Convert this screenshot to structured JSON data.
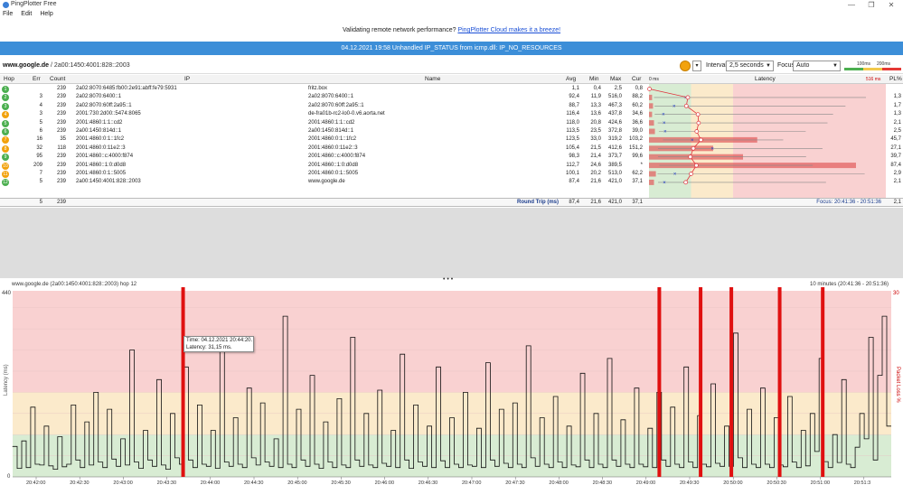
{
  "window": {
    "title": "PingPlotter Free",
    "minimize": "—",
    "maximize": "❐",
    "close": "✕"
  },
  "menu": [
    "File",
    "Edit",
    "Help"
  ],
  "promo": {
    "text": "Validating remote network performance?",
    "link": "PingPlotter Cloud makes it a breeze!"
  },
  "error": "04.12.2021 19:58 Unhandled IP_STATUS from icmp.dll: IP_NO_RESOURCES",
  "target": {
    "host": "www.google.de",
    "ip": "/ 2a00:1450:4001:828::2003"
  },
  "controls": {
    "interval_label": "Interval",
    "interval_value": "2,5 seconds",
    "focus_label": "Focus",
    "focus_value": "Auto"
  },
  "scale": {
    "t1": "100ms",
    "t2": "200ms"
  },
  "columns": {
    "hop": "Hop",
    "err": "Err",
    "count": "Count",
    "ip": "IP",
    "name": "Name",
    "avg": "Avg",
    "min": "Min",
    "max": "Max",
    "cur": "Cur",
    "lat0": "0 ms",
    "latency": "Latency",
    "latmax": "516 ms",
    "pl": "PL%"
  },
  "hops": [
    {
      "hop": "1",
      "err": "",
      "count": "239",
      "ip": "2a02:8070:6485:fb00:2e91:abff:fe79:5931",
      "name": "fritz.box",
      "avg": "1,1",
      "min": "0,4",
      "max": "2,5",
      "cur": "0,8",
      "pl": "",
      "color": "#4caf50",
      "avgv": 1.1,
      "minv": 0.4,
      "maxv": 2.5
    },
    {
      "hop": "2",
      "err": "3",
      "count": "239",
      "ip": "2a02:8070:6400::1",
      "name": "2a02:8070:6400::1",
      "avg": "92,4",
      "min": "11,9",
      "max": "516,0",
      "cur": "88,2",
      "pl": "1,3",
      "color": "#4caf50",
      "avgv": 92.4,
      "minv": 11.9,
      "maxv": 516
    },
    {
      "hop": "3",
      "err": "4",
      "count": "239",
      "ip": "2a02:8070:60ff:2a95::1",
      "name": "2a02:8070:60ff:2a95::1",
      "avg": "88,7",
      "min": "13,3",
      "max": "467,3",
      "cur": "60,2",
      "pl": "1,7",
      "color": "#4caf50",
      "avgv": 88.7,
      "minv": 13.3,
      "maxv": 467.3
    },
    {
      "hop": "4",
      "err": "3",
      "count": "239",
      "ip": "2001:730:2d00::5474:8065",
      "name": "de-fra01b-rc2-lo0-0.v6.aorta.net",
      "avg": "116,4",
      "min": "13,6",
      "max": "437,8",
      "cur": "34,6",
      "pl": "1,3",
      "color": "#f2a20d",
      "avgv": 116.4,
      "minv": 13.6,
      "maxv": 437.8
    },
    {
      "hop": "5",
      "err": "5",
      "count": "239",
      "ip": "2001:4860:1:1::cd2",
      "name": "2001:4860:1:1::cd2",
      "avg": "118,0",
      "min": "20,8",
      "max": "424,6",
      "cur": "36,6",
      "pl": "2,1",
      "color": "#4caf50",
      "avgv": 118,
      "minv": 20.8,
      "maxv": 424.6
    },
    {
      "hop": "6",
      "err": "6",
      "count": "239",
      "ip": "2a00:1450:814d::1",
      "name": "2a00:1450:814d::1",
      "avg": "113,5",
      "min": "23,5",
      "max": "372,8",
      "cur": "39,0",
      "pl": "2,5",
      "color": "#4caf50",
      "avgv": 113.5,
      "minv": 23.5,
      "maxv": 372.8
    },
    {
      "hop": "7",
      "err": "16",
      "count": "35",
      "ip": "2001:4860:0:1::1fc2",
      "name": "2001:4860:0:1::1fc2",
      "avg": "123,5",
      "min": "33,0",
      "max": "319,2",
      "cur": "103,2",
      "pl": "45,7",
      "color": "#f2a20d",
      "avgv": 123.5,
      "minv": 33,
      "maxv": 319.2
    },
    {
      "hop": "8",
      "err": "32",
      "count": "118",
      "ip": "2001:4860:0:11e2::3",
      "name": "2001:4860:0:11e2::3",
      "avg": "105,4",
      "min": "21,5",
      "max": "412,6",
      "cur": "151,2",
      "pl": "27,1",
      "color": "#f2a20d",
      "avgv": 105.4,
      "minv": 21.5,
      "maxv": 412.6
    },
    {
      "hop": "9",
      "err": "95",
      "count": "239",
      "ip": "2001:4860::c:4000:f874",
      "name": "2001:4860::c:4000:f874",
      "avg": "98,3",
      "min": "21,4",
      "max": "373,7",
      "cur": "99,6",
      "pl": "39,7",
      "color": "#4caf50",
      "avgv": 98.3,
      "minv": 21.4,
      "maxv": 373.7
    },
    {
      "hop": "10",
      "err": "209",
      "count": "239",
      "ip": "2001:4860::1:0:d0d8",
      "name": "2001:4860::1:0:d0d8",
      "avg": "112,7",
      "min": "24,6",
      "max": "389,5",
      "cur": "*",
      "pl": "87,4",
      "color": "#f2a20d",
      "avgv": 112.7,
      "minv": 24.6,
      "maxv": 389.5
    },
    {
      "hop": "11",
      "err": "7",
      "count": "239",
      "ip": "2001:4860:0:1::5005",
      "name": "2001:4860:0:1::5005",
      "avg": "100,1",
      "min": "20,2",
      "max": "513,0",
      "cur": "62,2",
      "pl": "2,9",
      "color": "#f2a20d",
      "avgv": 100.1,
      "minv": 20.2,
      "maxv": 513
    },
    {
      "hop": "12",
      "err": "5",
      "count": "239",
      "ip": "2a00:1450:4001:828::2003",
      "name": "www.google.de",
      "avg": "87,4",
      "min": "21,6",
      "max": "421,0",
      "cur": "37,1",
      "pl": "2,1",
      "color": "#4caf50",
      "avgv": 87.4,
      "minv": 21.6,
      "maxv": 421
    }
  ],
  "summary": {
    "err": "5",
    "count": "239",
    "label": "Round Trip (ms)",
    "avg": "87,4",
    "min": "21,6",
    "max": "421,0",
    "cur": "37,1",
    "focus": "Focus: 20:41:36 - 20:51:36",
    "pl": "2,1"
  },
  "graph": {
    "title": "www.google.de (2a00:1450:4001:828::2003) hop 12",
    "range": "10 minutes (20:41:36 - 20:51:36)",
    "ylabel": "Latency (ms)",
    "yright": "Packet Loss %",
    "ymax": "440",
    "ymin": "0",
    "pmax": "30",
    "xticks": [
      "20:42:00",
      "20:42:30",
      "20:43:00",
      "20:43:30",
      "20:44:00",
      "20:44:30",
      "20:45:00",
      "20:45:30",
      "20:46:00",
      "20:46:30",
      "20:47:00",
      "20:47:30",
      "20:48:00",
      "20:48:30",
      "20:49:00",
      "20:49:30",
      "20:50:00",
      "20:50:30",
      "20:51:00",
      "20:51:3"
    ],
    "tooltip": {
      "line1": "Time: 04.12.2021 20:44:20.",
      "line2": "Latency: 31,15 ms."
    }
  },
  "chart_data": {
    "type": "line",
    "ylabel": "Latency (ms)",
    "ylim": [
      0,
      440
    ],
    "bands": [
      {
        "from": 0,
        "to": 100,
        "color": "#d8ecd3"
      },
      {
        "from": 100,
        "to": 200,
        "color": "#fbeacb"
      },
      {
        "from": 200,
        "to": 440,
        "color": "#f9d1d1"
      }
    ],
    "loss_x": [
      0.194,
      0.736,
      0.783,
      0.818,
      0.873,
      0.922
    ],
    "values": [
      72,
      20,
      85,
      22,
      165,
      30,
      28,
      120,
      26,
      18,
      95,
      24,
      30,
      170,
      40,
      22,
      130,
      28,
      200,
      35,
      22,
      160,
      42,
      25,
      90,
      28,
      300,
      35,
      20,
      110,
      40,
      25,
      230,
      28,
      18,
      150,
      45,
      30,
      260,
      40,
      22,
      170,
      30,
      25,
      110,
      20,
      320,
      35,
      25,
      140,
      30,
      22,
      210,
      45,
      28,
      175,
      35,
      25,
      90,
      22,
      380,
      30,
      22,
      160,
      40,
      25,
      240,
      30,
      20,
      130,
      35,
      22,
      185,
      28,
      22,
      330,
      40,
      25,
      150,
      28,
      22,
      205,
      32,
      25,
      110,
      22,
      290,
      40,
      20,
      170,
      35,
      25,
      120,
      22,
      260,
      38,
      22,
      140,
      30,
      22,
      200,
      28,
      25,
      115,
      22,
      270,
      40,
      25,
      160,
      32,
      22,
      175,
      30,
      22,
      310,
      45,
      25,
      140,
      30,
      22,
      190,
      35,
      22,
      120,
      28,
      24,
      245,
      40,
      22,
      150,
      30,
      22,
      280,
      40,
      25,
      135,
      30,
      22,
      210,
      30,
      24,
      115,
      22,
      200,
      40,
      25,
      165,
      30,
      22,
      260,
      35,
      22,
      145,
      30,
      24,
      220,
      32,
      25,
      120,
      25,
      340,
      45,
      22,
      160,
      30,
      22,
      210,
      30,
      22,
      140,
      28,
      24,
      190,
      35,
      22,
      110,
      26,
      150,
      60,
      280,
      36,
      22,
      100,
      34,
      230,
      30,
      22,
      70,
      150,
      90,
      330,
      40,
      240,
      380,
      120
    ]
  }
}
